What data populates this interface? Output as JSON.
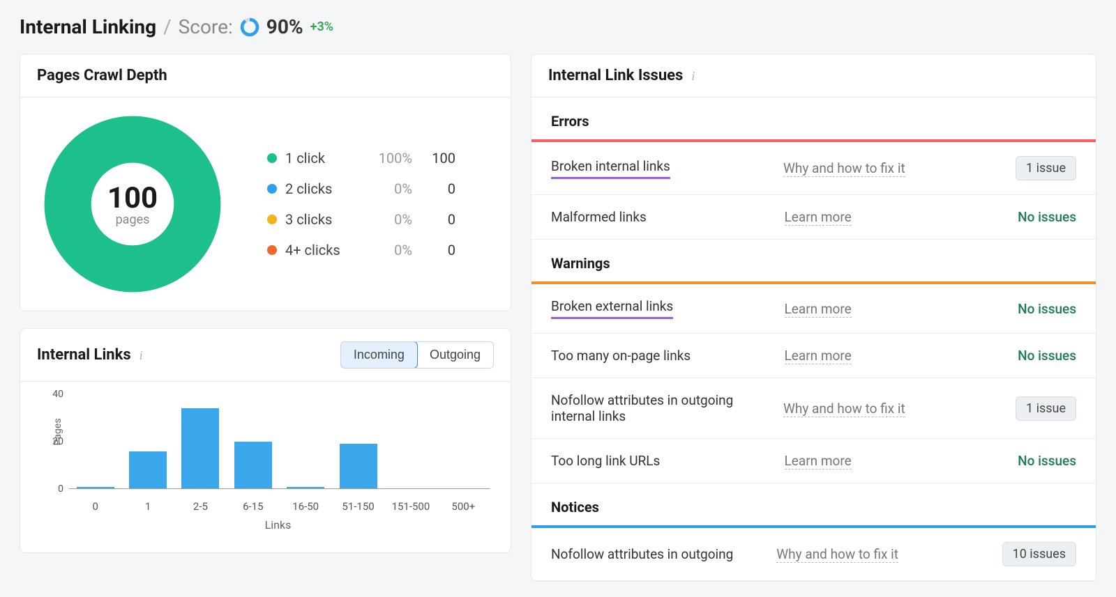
{
  "header": {
    "title": "Internal Linking",
    "sep": "/",
    "score_label": "Score:",
    "score_value": "90%",
    "score_delta": "+3%"
  },
  "crawl_depth": {
    "title": "Pages Crawl Depth",
    "total": "100",
    "total_label": "pages",
    "legend": [
      {
        "label": "1 click",
        "pct": "100%",
        "count": "100",
        "color": "#1dbf8c"
      },
      {
        "label": "2 clicks",
        "pct": "0%",
        "count": "0",
        "color": "#2f9eed"
      },
      {
        "label": "3 clicks",
        "pct": "0%",
        "count": "0",
        "color": "#f1b41d"
      },
      {
        "label": "4+ clicks",
        "pct": "0%",
        "count": "0",
        "color": "#f1692a"
      }
    ]
  },
  "internal_links": {
    "title": "Internal Links",
    "toggle": {
      "incoming": "Incoming",
      "outgoing": "Outgoing",
      "active": "incoming"
    },
    "y_label": "Pages",
    "x_label": "Links"
  },
  "chart_data": {
    "type": "bar",
    "title": "Internal Links (Incoming)",
    "xlabel": "Links",
    "ylabel": "Pages",
    "categories": [
      "0",
      "1",
      "2-5",
      "6-15",
      "16-50",
      "51-150",
      "151-500",
      "500+"
    ],
    "values": [
      1,
      16,
      34,
      20,
      1,
      19,
      0,
      0
    ],
    "ylim": [
      0,
      40
    ],
    "yticks": [
      0,
      20,
      40
    ]
  },
  "issues_panel": {
    "title": "Internal Link Issues",
    "sections": {
      "errors": "Errors",
      "warnings": "Warnings",
      "notices": "Notices"
    },
    "learn_more": "Learn more",
    "why_fix": "Why and how to fix it",
    "no_issues": "No issues",
    "items": {
      "errors": [
        {
          "name": "Broken internal links",
          "link": "why_fix",
          "status": "1 issue",
          "highlight": true
        },
        {
          "name": "Malformed links",
          "link": "learn_more",
          "status": "no_issues",
          "highlight": false
        }
      ],
      "warnings": [
        {
          "name": "Broken external links",
          "link": "learn_more",
          "status": "no_issues",
          "highlight": true
        },
        {
          "name": "Too many on-page links",
          "link": "learn_more",
          "status": "no_issues",
          "highlight": false
        },
        {
          "name": "Nofollow attributes in outgoing internal links",
          "link": "why_fix",
          "status": "1 issue",
          "highlight": false
        },
        {
          "name": "Too long link URLs",
          "link": "learn_more",
          "status": "no_issues",
          "highlight": false
        }
      ],
      "notices": [
        {
          "name": "Nofollow attributes in outgoing",
          "link": "why_fix",
          "status": "10 issues",
          "highlight": false
        }
      ]
    }
  }
}
